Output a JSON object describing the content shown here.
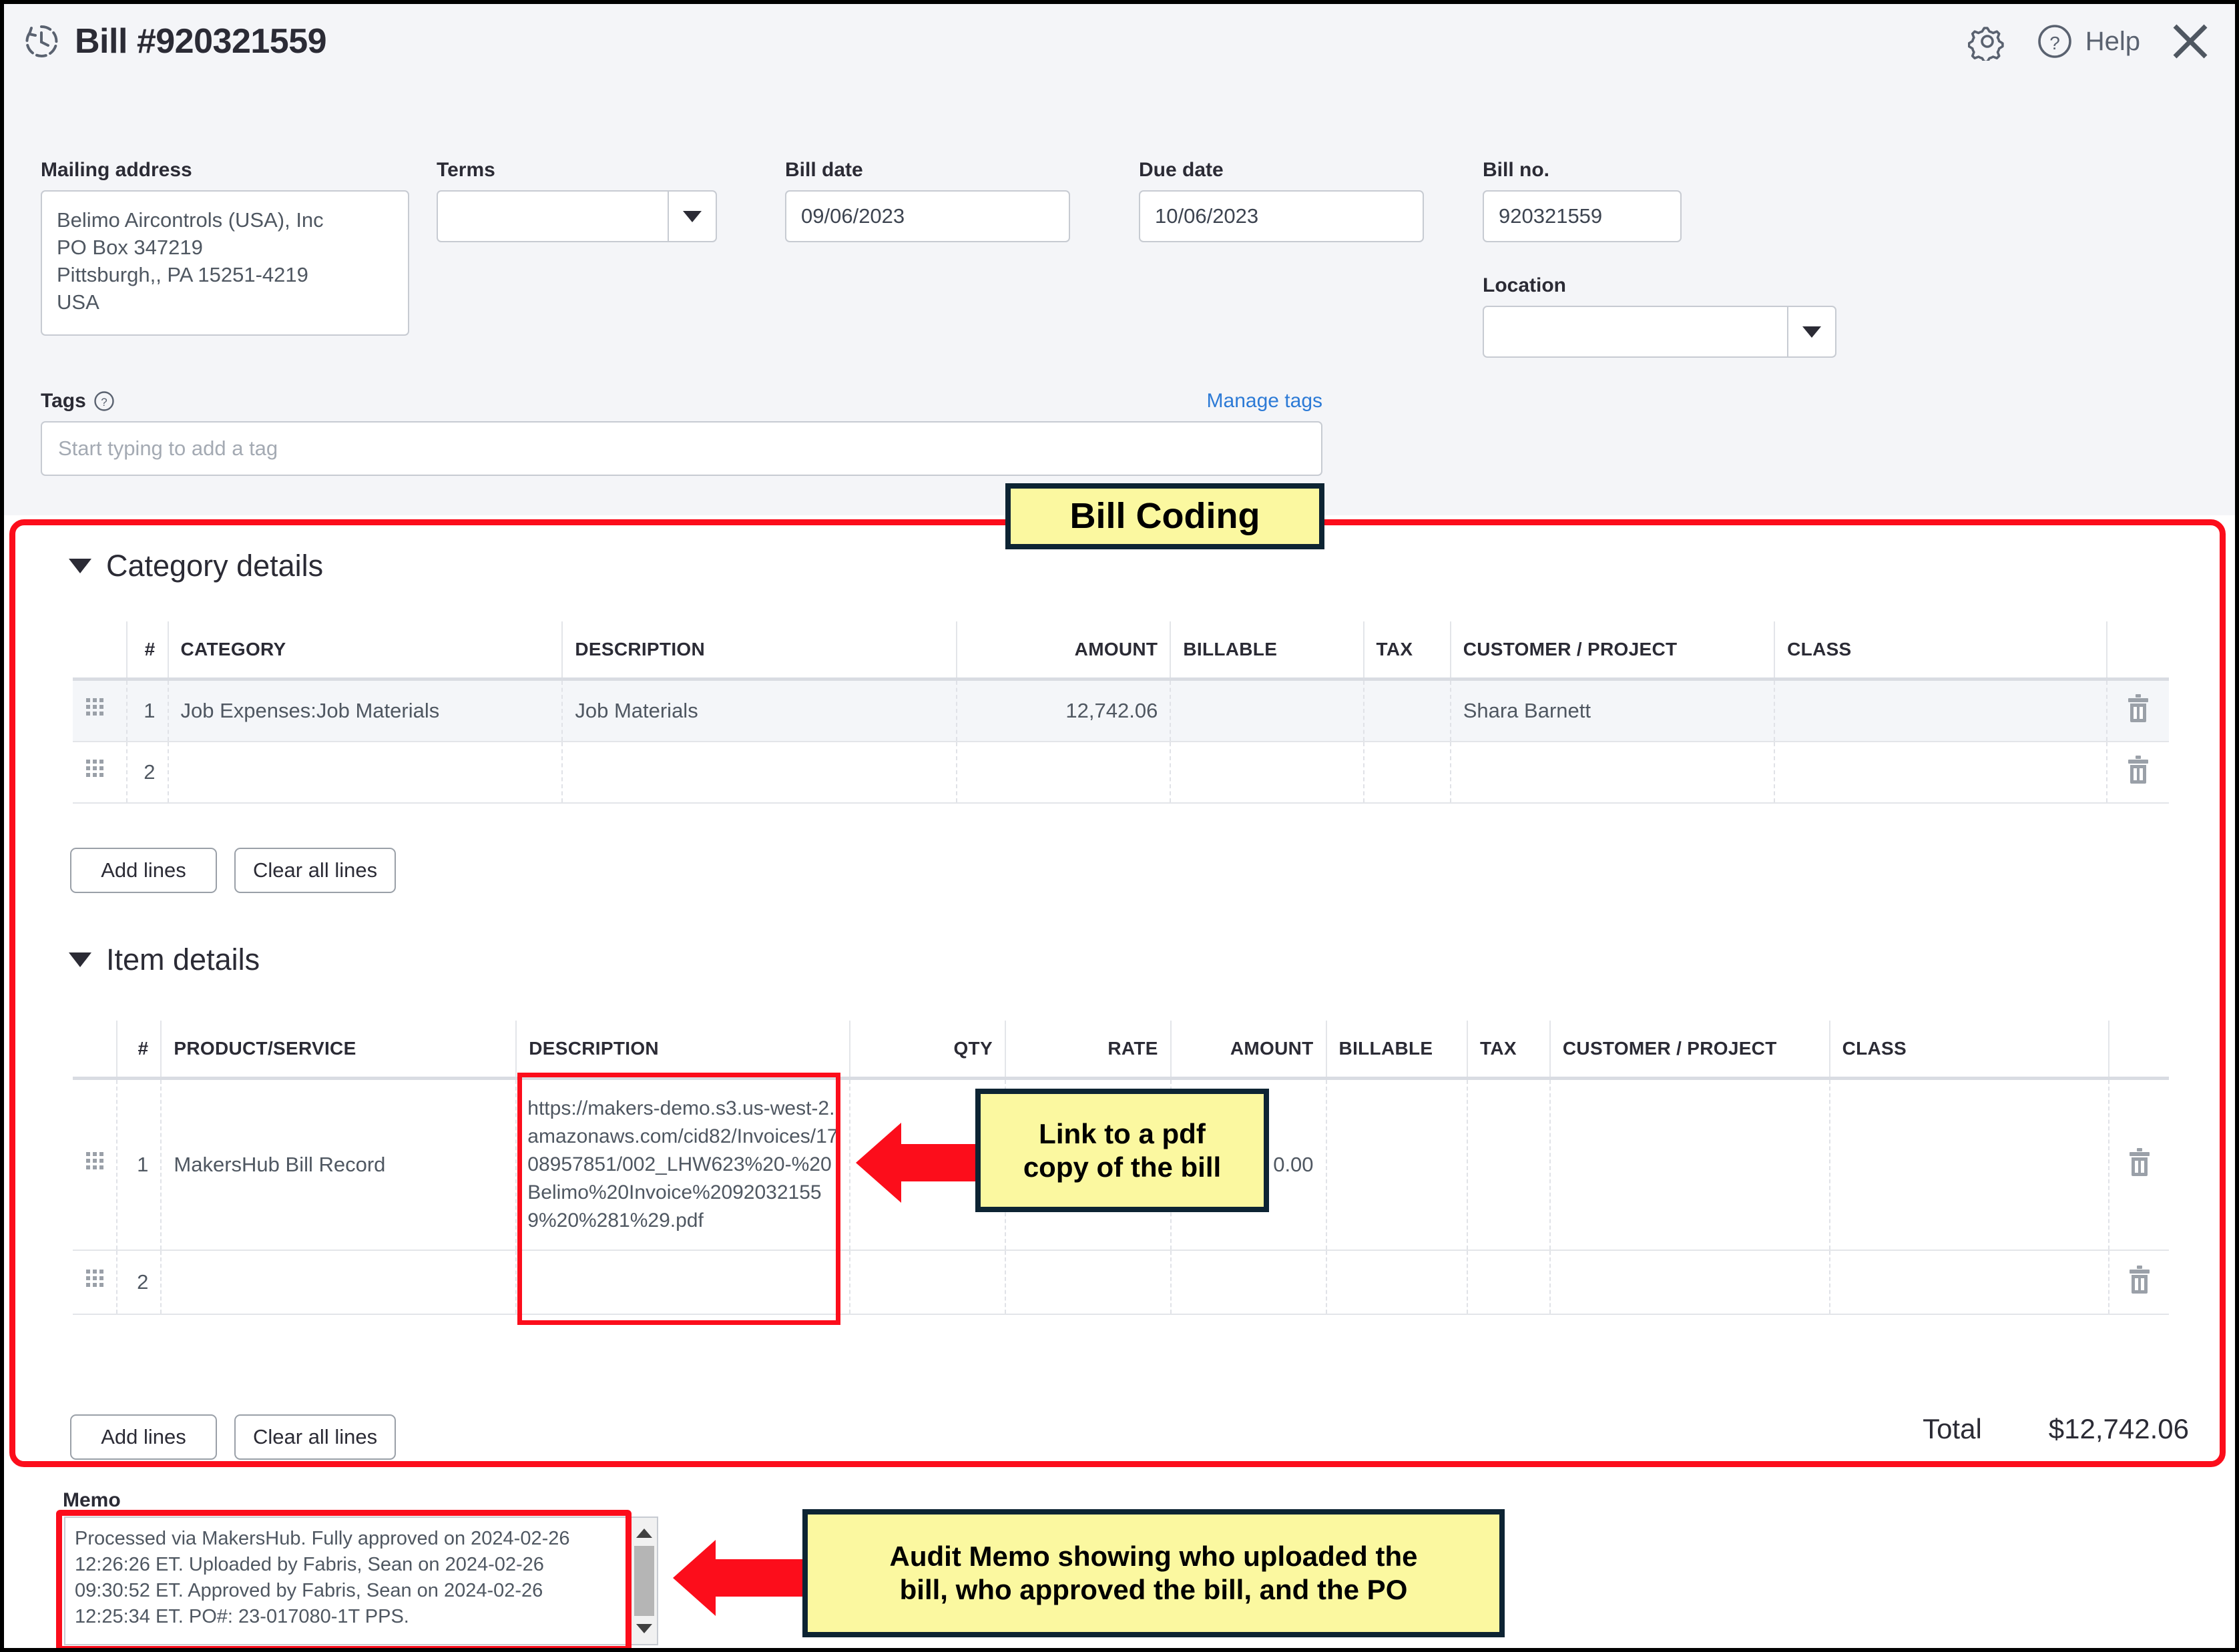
{
  "header": {
    "title": "Bill #920321559",
    "help_label": "Help",
    "icons": {
      "history": "clock-history-icon",
      "settings": "gear-icon",
      "help": "question-circle-icon",
      "close": "close-icon"
    }
  },
  "form": {
    "mailing_address_label": "Mailing address",
    "mailing_address_value": "Belimo Aircontrols (USA), Inc\nPO Box 347219\nPittsburgh,, PA  15251-4219\nUSA",
    "mailing_address_lines": [
      "Belimo Aircontrols (USA), Inc",
      "PO Box 347219",
      "Pittsburgh,, PA  15251-4219",
      "USA"
    ],
    "terms_label": "Terms",
    "terms_value": "",
    "bill_date_label": "Bill date",
    "bill_date_value": "09/06/2023",
    "due_date_label": "Due date",
    "due_date_value": "10/06/2023",
    "bill_no_label": "Bill no.",
    "bill_no_value": "920321559",
    "location_label": "Location",
    "location_value": ""
  },
  "tags": {
    "label": "Tags",
    "manage_link": "Manage tags",
    "placeholder": "Start typing to add a tag",
    "value": ""
  },
  "category_details": {
    "title": "Category details",
    "columns": [
      "#",
      "CATEGORY",
      "DESCRIPTION",
      "AMOUNT",
      "BILLABLE",
      "TAX",
      "CUSTOMER / PROJECT",
      "CLASS"
    ],
    "rows": [
      {
        "num": "1",
        "category": "Job Expenses:Job Materials",
        "description": "Job Materials",
        "amount": "12,742.06",
        "billable": "",
        "tax": "",
        "customer_project": "Shara Barnett",
        "class": ""
      },
      {
        "num": "2",
        "category": "",
        "description": "",
        "amount": "",
        "billable": "",
        "tax": "",
        "customer_project": "",
        "class": ""
      }
    ],
    "add_lines_label": "Add lines",
    "clear_all_lines_label": "Clear all lines"
  },
  "item_details": {
    "title": "Item details",
    "columns": [
      "#",
      "PRODUCT/SERVICE",
      "DESCRIPTION",
      "QTY",
      "RATE",
      "AMOUNT",
      "BILLABLE",
      "TAX",
      "CUSTOMER / PROJECT",
      "CLASS"
    ],
    "rows": [
      {
        "num": "1",
        "product_service": "MakersHub Bill Record",
        "description": "https://makers-demo.s3.us-west-2.amazonaws.com/cid82/Invoices/1708957851/002_LHW623%20-%20Belimo%20Invoice%20920321559%20%281%29.pdf",
        "qty": "",
        "rate": "",
        "amount": "0.00",
        "billable": "",
        "tax": "",
        "customer_project": "",
        "class": ""
      },
      {
        "num": "2",
        "product_service": "",
        "description": "",
        "qty": "",
        "rate": "",
        "amount": "",
        "billable": "",
        "tax": "",
        "customer_project": "",
        "class": ""
      }
    ],
    "add_lines_label": "Add lines",
    "clear_all_lines_label": "Clear all lines",
    "total_label": "Total",
    "total_value": "$12,742.06"
  },
  "memo": {
    "label": "Memo",
    "value": "Processed via MakersHub. Fully approved on 2024-02-26 12:26:26 ET. Uploaded by Fabris, Sean on 2024-02-26 09:30:52 ET. Approved by Fabris, Sean on 2024-02-26 12:25:34 ET. PO#: 23-017080-1T PPS."
  },
  "annotations": {
    "bill_coding": "Bill Coding",
    "pdf_link": "Link to a pdf\ncopy of the bill",
    "pdf_link_line1": "Link to a pdf",
    "pdf_link_line2": "copy of the bill",
    "audit_memo_line1": "Audit Memo showing who uploaded the",
    "audit_memo_line2": "bill, who approved the bill, and the PO"
  },
  "colors": {
    "highlight_red": "#fc0d1b",
    "callout_fill": "#fbf8a0",
    "callout_border": "#0d2433",
    "link_blue": "#2c7ad6",
    "header_bg": "#f4f5f8"
  }
}
